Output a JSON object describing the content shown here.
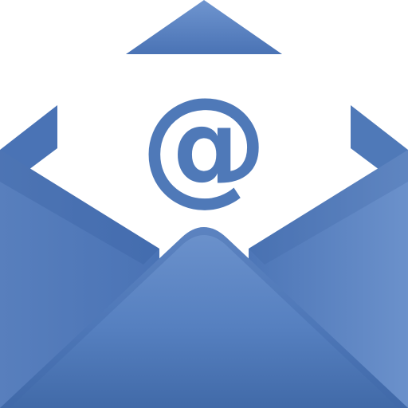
{
  "icon": {
    "name": "open-envelope-email-icon",
    "symbol": "@",
    "colors": {
      "primary_blue": "#4f79b8",
      "deep_blue": "#3f68a8",
      "light_blue": "#6f95cf",
      "paper_white": "#ffffff"
    }
  }
}
